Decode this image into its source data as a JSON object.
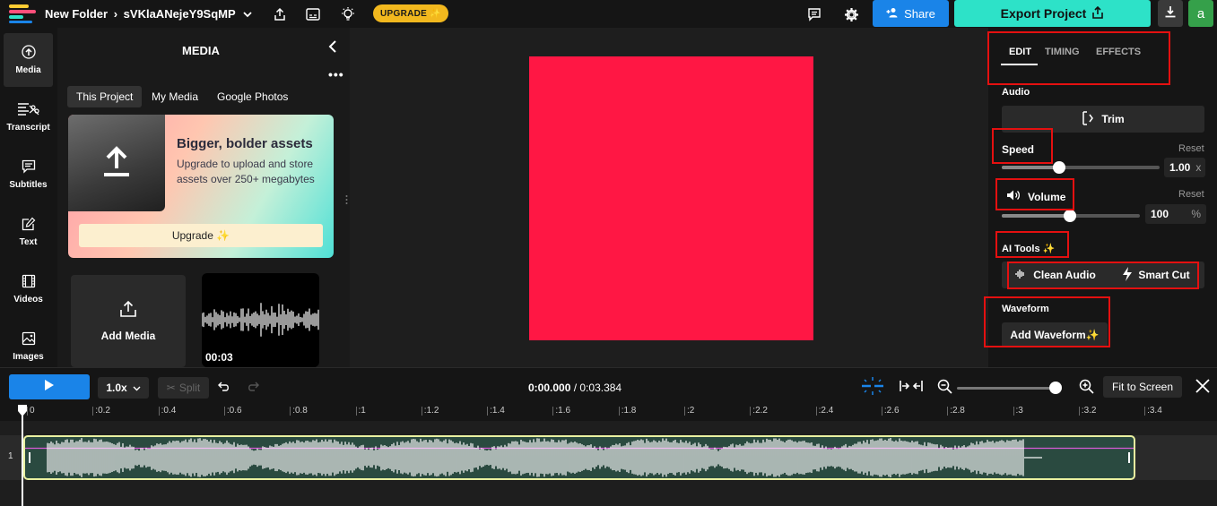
{
  "topbar": {
    "folder": "New Folder",
    "project_name": "sVKlaANejeY9SqMP",
    "upgrade_label": "UPGRADE ✨",
    "share_label": "Share",
    "export_label": "Export Project",
    "avatar_letter": "a"
  },
  "leftnav": {
    "items": [
      {
        "label": "Media",
        "icon": "upload-cloud-icon"
      },
      {
        "label": "Transcript",
        "icon": "transcript-icon"
      },
      {
        "label": "Subtitles",
        "icon": "subtitles-icon"
      },
      {
        "label": "Text",
        "icon": "text-edit-icon"
      },
      {
        "label": "Videos",
        "icon": "film-icon"
      },
      {
        "label": "Images",
        "icon": "image-icon"
      }
    ]
  },
  "media": {
    "title": "MEDIA",
    "tabs": [
      "This Project",
      "My Media",
      "Google Photos"
    ],
    "promo_heading": "Bigger, bolder assets",
    "promo_text": "Upgrade to upload and store assets over 250+ megabytes",
    "promo_button": "Upgrade ✨",
    "add_media": "Add Media",
    "audio_duration": "00:03"
  },
  "right_panel": {
    "tabs": [
      "EDIT",
      "TIMING",
      "EFFECTS"
    ],
    "audio_label": "Audio",
    "trim_label": "Trim",
    "speed_label": "Speed",
    "speed_reset": "Reset",
    "speed_value": "1.00",
    "speed_unit": "x",
    "volume_label": "Volume",
    "volume_reset": "Reset",
    "volume_value": "100",
    "volume_unit": "%",
    "ai_tools_label": "AI Tools ✨",
    "clean_audio": "Clean Audio",
    "smart_cut": "Smart Cut",
    "waveform_label": "Waveform",
    "add_waveform": "Add Waveform✨"
  },
  "timeline": {
    "speed": "1.0x",
    "split": "Split",
    "current_time": "0:00.000",
    "total_time": "/ 0:03.384",
    "fit_label": "Fit to Screen",
    "ticks": [
      "0",
      ":0.2",
      ":0.4",
      ":0.6",
      ":0.8",
      ":1",
      ":1.2",
      ":1.4",
      ":1.6",
      ":1.8",
      ":2",
      ":2.2",
      ":2.4",
      ":2.6",
      ":2.8",
      ":3",
      ":3.2",
      ":3.4"
    ],
    "track_number": "1"
  },
  "colors": {
    "canvas": "#ff1744",
    "accent_blue": "#1a84e8",
    "export_teal": "#2de2c8",
    "upgrade_yellow": "#f2b81e",
    "annotation_red": "#e41010"
  }
}
